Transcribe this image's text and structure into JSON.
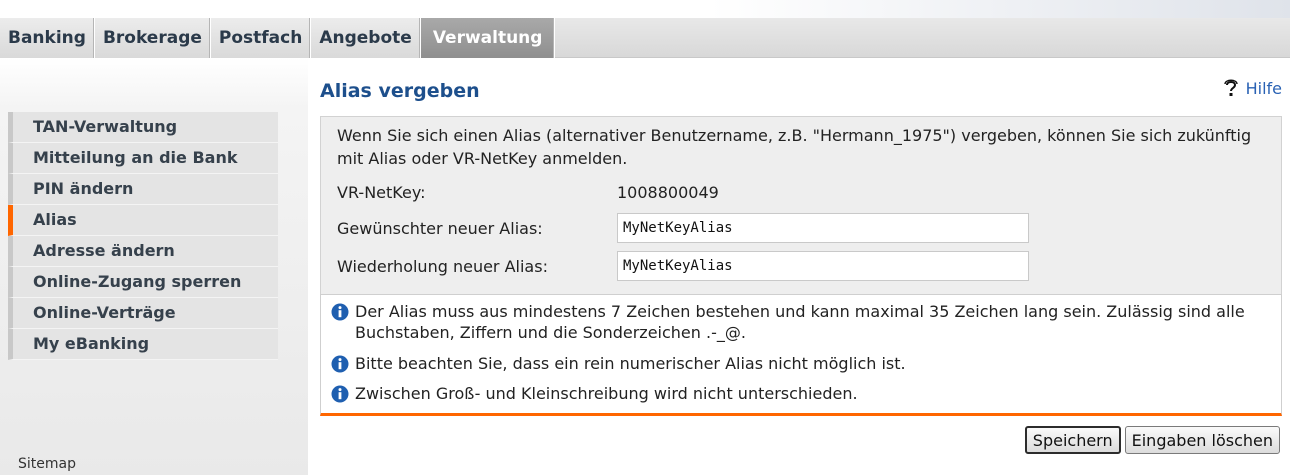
{
  "tabs": [
    {
      "label": "Banking"
    },
    {
      "label": "Brokerage"
    },
    {
      "label": "Postfach"
    },
    {
      "label": "Angebote"
    },
    {
      "label": "Verwaltung",
      "active": true
    }
  ],
  "sidebar": {
    "items": [
      {
        "label": "TAN-Verwaltung"
      },
      {
        "label": "Mitteilung an die Bank"
      },
      {
        "label": "PIN ändern"
      },
      {
        "label": "Alias",
        "active": true
      },
      {
        "label": "Adresse ändern"
      },
      {
        "label": "Online-Zugang sperren"
      },
      {
        "label": "Online-Verträge"
      },
      {
        "label": "My eBanking"
      }
    ],
    "sitemap": "Sitemap"
  },
  "main": {
    "title": "Alias vergeben",
    "help": "Hilfe",
    "intro": "Wenn Sie sich einen Alias (alternativer Benutzername, z.B. \"Hermann_1975\") vergeben, können Sie sich zukünftig mit Alias oder VR-NetKey anmelden.",
    "netkey_label": "VR-NetKey:",
    "netkey_value": "1008800049",
    "alias_label": "Gewünschter neuer Alias:",
    "alias_value": "MyNetKeyAlias",
    "repeat_label": "Wiederholung neuer Alias:",
    "repeat_value": "MyNetKeyAlias",
    "info": [
      "Der Alias muss aus mindestens 7 Zeichen bestehen und kann maximal 35 Zeichen lang sein. Zulässig sind alle Buchstaben, Ziffern und die Sonderzeichen .-_@.",
      "Bitte beachten Sie, dass ein rein numerischer Alias nicht möglich ist.",
      "Zwischen Groß- und Kleinschreibung wird nicht unterschieden."
    ],
    "save_label": "Speichern",
    "clear_label": "Eingaben löschen"
  },
  "colors": {
    "accent": "#ff6600",
    "title": "#1d4f8c",
    "link": "#2a62b4",
    "info_icon": "#1f5fb0"
  },
  "icons": {
    "help": "help-icon",
    "info": "info-icon"
  }
}
